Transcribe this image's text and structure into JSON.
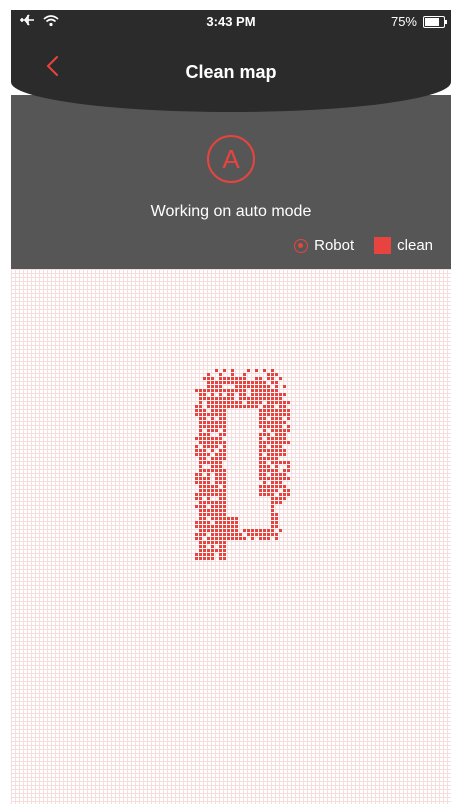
{
  "status_bar": {
    "time": "3:43 PM",
    "battery": "75%",
    "battery_level": 0.75,
    "icons": [
      "airplane-icon",
      "wifi-icon"
    ]
  },
  "header": {
    "title": "Clean map",
    "back_icon": "chevron-left-icon"
  },
  "mode": {
    "badge": "A",
    "status": "Working on auto mode"
  },
  "legend": {
    "robot_label": "Robot",
    "clean_label": "clean"
  },
  "colors": {
    "accent": "#e8443f",
    "header_bg": "#2b2b2b",
    "panel_bg": "#565656",
    "grid": "#f6dede"
  }
}
